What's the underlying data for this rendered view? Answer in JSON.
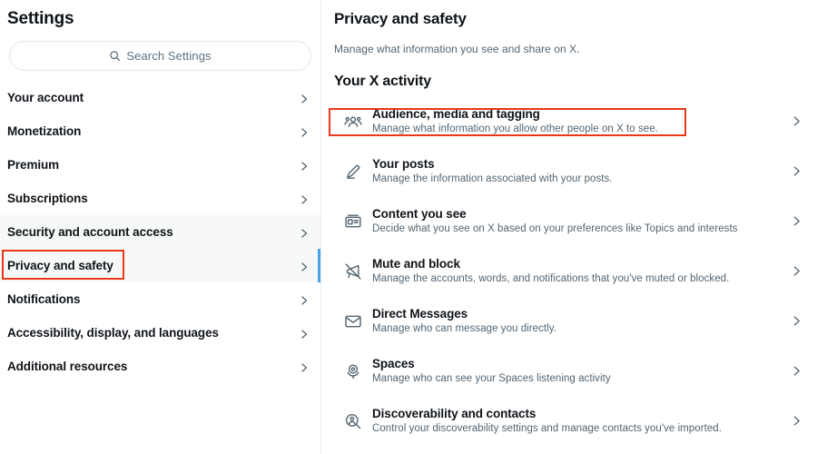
{
  "sidebar": {
    "title": "Settings",
    "search": {
      "placeholder": "Search Settings",
      "icon": "search-icon",
      "value": ""
    },
    "items": [
      {
        "label": "Your account",
        "shaded": false,
        "active": false,
        "chevron": "chevron-right-icon"
      },
      {
        "label": "Monetization",
        "shaded": false,
        "active": false,
        "chevron": "chevron-right-icon"
      },
      {
        "label": "Premium",
        "shaded": false,
        "active": false,
        "chevron": "chevron-right-icon"
      },
      {
        "label": "Subscriptions",
        "shaded": false,
        "active": false,
        "chevron": "chevron-right-icon"
      },
      {
        "label": "Security and account access",
        "shaded": true,
        "active": false,
        "chevron": "chevron-right-icon"
      },
      {
        "label": "Privacy and safety",
        "shaded": true,
        "active": true,
        "chevron": "chevron-right-icon"
      },
      {
        "label": "Notifications",
        "shaded": false,
        "active": false,
        "chevron": "chevron-right-icon"
      },
      {
        "label": "Accessibility, display, and languages",
        "shaded": false,
        "active": false,
        "chevron": "chevron-right-icon"
      },
      {
        "label": "Additional resources",
        "shaded": false,
        "active": false,
        "chevron": "chevron-right-icon"
      }
    ]
  },
  "main": {
    "title": "Privacy and safety",
    "subtitle": "Manage what information you see and share on X.",
    "section_title": "Your X activity",
    "rows": [
      {
        "icon": "people-group-icon",
        "title": "Audience, media and tagging",
        "desc": "Manage what information you allow other people on X to see.",
        "chevron": "chevron-right-icon",
        "highlighted": true
      },
      {
        "icon": "pencil-edit-icon",
        "title": "Your posts",
        "desc": "Manage the information associated with your posts.",
        "chevron": "chevron-right-icon",
        "highlighted": false
      },
      {
        "icon": "newspaper-icon",
        "title": "Content you see",
        "desc": "Decide what you see on X based on your preferences like Topics and interests",
        "chevron": "chevron-right-icon",
        "highlighted": false
      },
      {
        "icon": "muted-megaphone-icon",
        "title": "Mute and block",
        "desc": "Manage the accounts, words, and notifications that you've muted or blocked.",
        "chevron": "chevron-right-icon",
        "highlighted": false
      },
      {
        "icon": "envelope-icon",
        "title": "Direct Messages",
        "desc": "Manage who can message you directly.",
        "chevron": "chevron-right-icon",
        "highlighted": false
      },
      {
        "icon": "microphone-icon",
        "title": "Spaces",
        "desc": "Manage who can see your Spaces listening activity",
        "chevron": "chevron-right-icon",
        "highlighted": false
      },
      {
        "icon": "search-person-icon",
        "title": "Discoverability and contacts",
        "desc": "Control your discoverability settings and manage contacts you've imported.",
        "chevron": "chevron-right-icon",
        "highlighted": false
      }
    ]
  },
  "annotations": {
    "color": "#e8381a",
    "boxes": [
      {
        "name": "sidebar-privacy-and-safety-highlight",
        "target": "Privacy and safety"
      },
      {
        "name": "main-audience-media-tagging-highlight",
        "target": "Audience, media and tagging"
      }
    ]
  },
  "colors": {
    "accent_blue": "#4aa3e8",
    "text_primary": "#0f1419",
    "text_secondary": "#536471",
    "row_shaded": "#f7f9f9",
    "border": "#e6ecf0",
    "annotation_red": "#e8381a"
  }
}
